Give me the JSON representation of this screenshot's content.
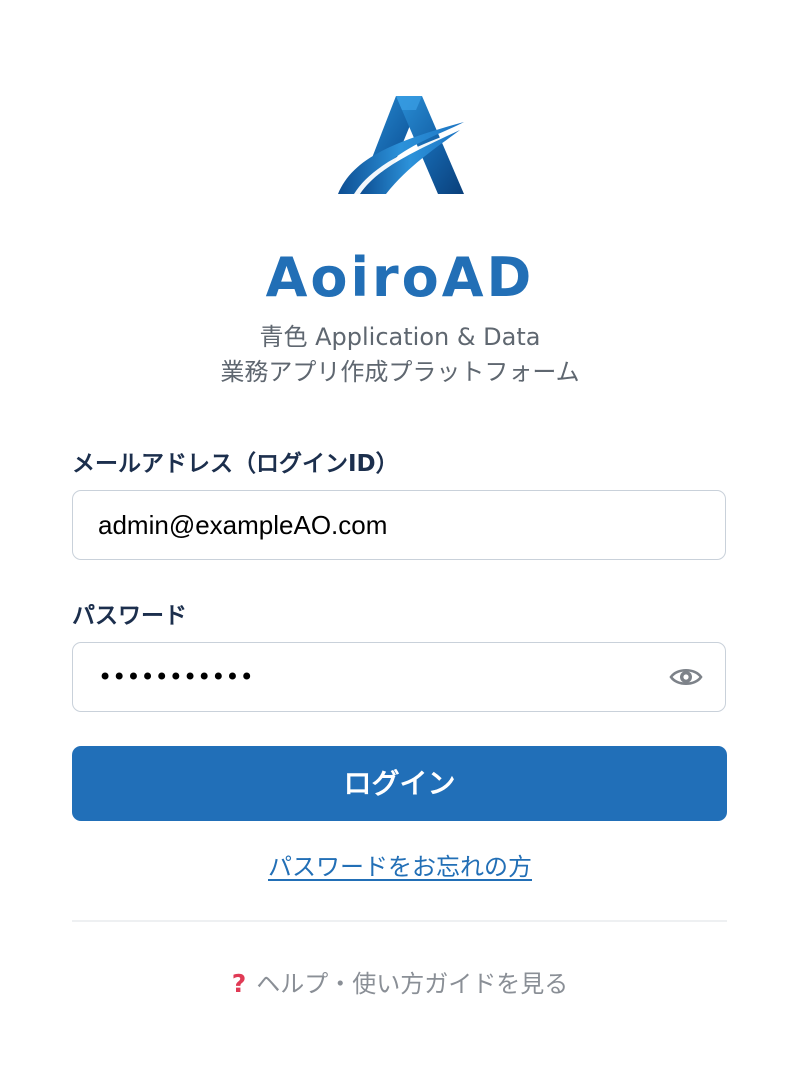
{
  "brand": {
    "logo_icon": "aoiro-a-logo",
    "name": "AoiroAD",
    "tagline_line1": "青色 Application & Data",
    "tagline_line2": "業務アプリ作成プラットフォーム"
  },
  "login_form": {
    "email_label": "メールアドレス（ログインID）",
    "email_value": "admin@exampleAO.com",
    "password_label": "パスワード",
    "password_value": "•••••••••••",
    "password_toggle_icon": "eye-icon",
    "submit_label": "ログイン"
  },
  "links": {
    "forgot_password": "パスワードをお忘れの方",
    "help_icon": "question-mark-icon",
    "help": "ヘルプ・使い方ガイドを見る"
  },
  "colors": {
    "brand_blue": "#226fb6",
    "button_blue": "#216fb8",
    "heading_navy": "#1c2f4d",
    "help_icon_red": "#e03a55",
    "muted_text": "#8a8f96"
  }
}
